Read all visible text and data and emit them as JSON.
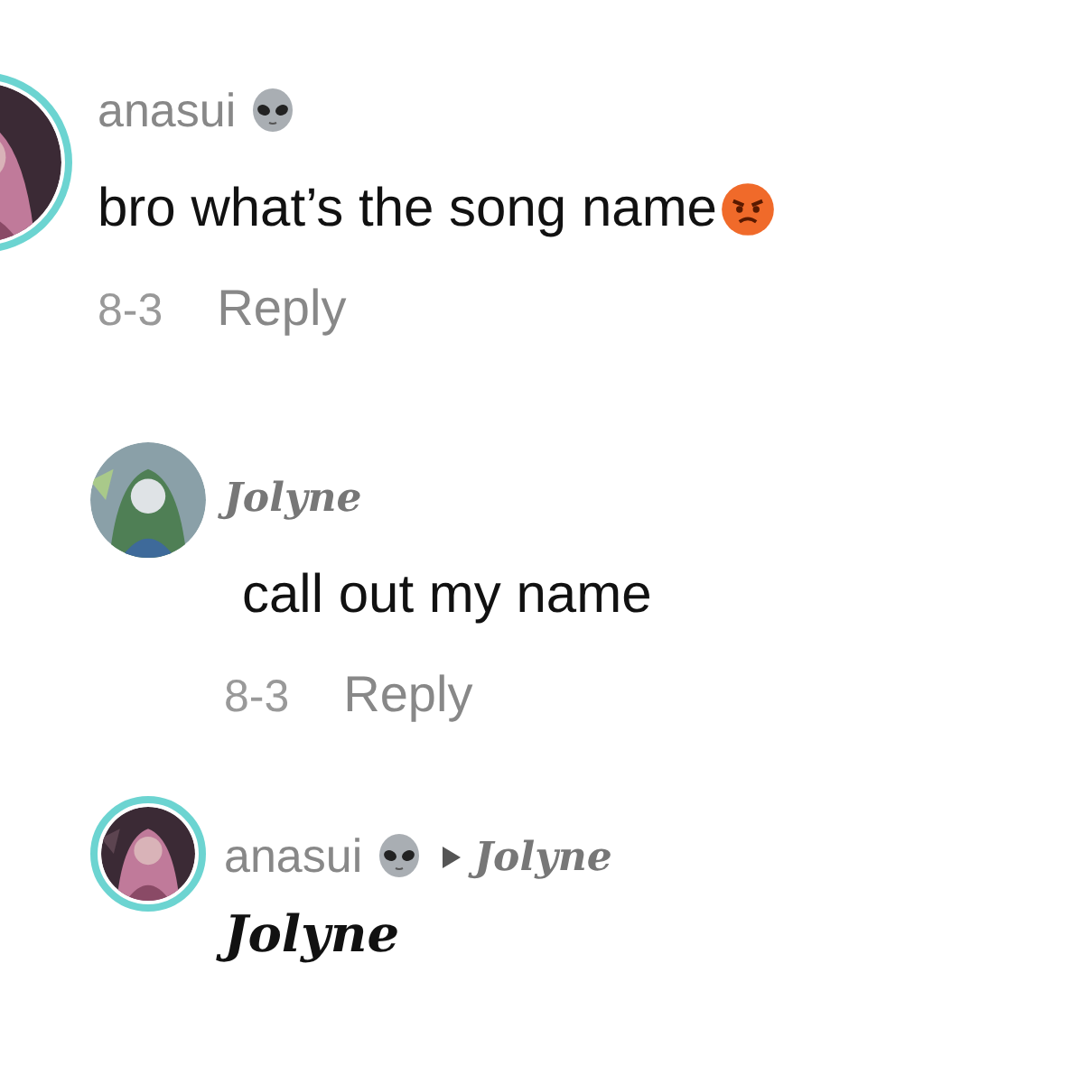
{
  "comments": [
    {
      "author": "anasui",
      "author_badge": {
        "kind": "alien"
      },
      "author_fancy": false,
      "ring": true,
      "text": "bro what’s the song name",
      "text_fancy": false,
      "text_emoji": {
        "kind": "angry-face"
      },
      "date": "8-3",
      "reply_label": "Reply",
      "children": [
        {
          "author": "Jolyne",
          "author_fancy": true,
          "ring": false,
          "text": "call out my name",
          "text_fancy": false,
          "date": "8-3",
          "reply_label": "Reply"
        },
        {
          "author": "anasui",
          "author_badge": {
            "kind": "alien"
          },
          "author_fancy": false,
          "ring": true,
          "reply_to": "Jolyne",
          "reply_to_fancy": true,
          "text": "Jolyne",
          "text_fancy": true
        }
      ]
    }
  ]
}
